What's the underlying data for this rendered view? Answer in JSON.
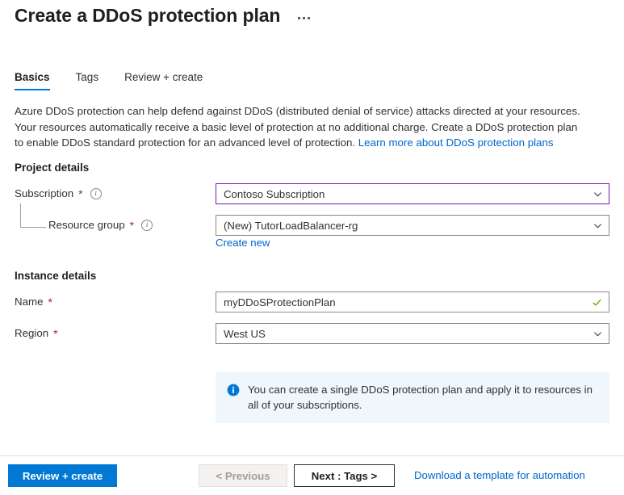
{
  "header": {
    "title": "Create a DDoS protection plan",
    "more_menu_label": "..."
  },
  "tabs": [
    {
      "label": "Basics",
      "active": true
    },
    {
      "label": "Tags",
      "active": false
    },
    {
      "label": "Review + create",
      "active": false
    }
  ],
  "description": {
    "body": "Azure DDoS protection can help defend against DDoS (distributed denial of service) attacks directed at your resources. Your resources automatically receive a basic level of protection at no additional charge. Create a DDoS protection plan to enable DDoS standard protection for an advanced level of protection.",
    "link_label": "Learn more about DDoS protection plans"
  },
  "project_details": {
    "heading": "Project details",
    "subscription": {
      "label": "Subscription",
      "required_marker": "*",
      "value": "Contoso Subscription",
      "focused": true
    },
    "resource_group": {
      "label": "Resource group",
      "required_marker": "*",
      "value": "(New) TutorLoadBalancer-rg",
      "create_new_label": "Create new"
    }
  },
  "instance_details": {
    "heading": "Instance details",
    "name": {
      "label": "Name",
      "required_marker": "*",
      "value": "myDDoSProtectionPlan",
      "validated": true
    },
    "region": {
      "label": "Region",
      "required_marker": "*",
      "value": "West US"
    }
  },
  "info_banner": {
    "text": "You can create a single DDoS protection plan and apply it to resources in all of your subscriptions."
  },
  "footer": {
    "review_create_label": "Review + create",
    "previous_label": "< Previous",
    "next_label": "Next : Tags >",
    "template_link_label": "Download a template for automation"
  },
  "colors": {
    "accent_blue": "#0078d4",
    "link_blue": "#0066cc",
    "focus_purple": "#7719aa",
    "required_red": "#a4262c",
    "success_green": "#5ba300",
    "banner_bg": "#eff6fc"
  }
}
